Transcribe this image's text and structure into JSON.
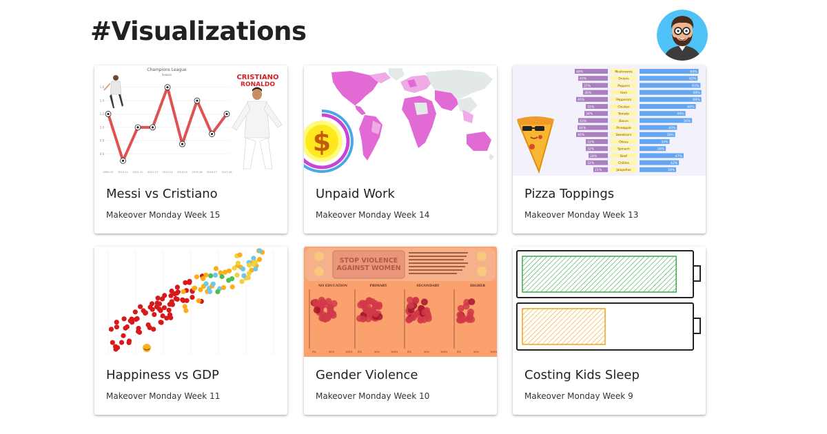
{
  "page": {
    "title": "#Visualizations"
  },
  "profile": {
    "avatar_icon": "bearded-man-avatar",
    "avatar_bg": "#4fc3f7"
  },
  "cards": [
    {
      "title": "Messi vs Cristiano",
      "subtitle": "Makeover Monday Week 15",
      "thumbnail": {
        "icon": "line-chart-thumbnail",
        "chart_title": "Champions League",
        "chart_subtitle": "Season",
        "player_name_line1": "CRISTIANO",
        "player_name_line2": "RONALDO",
        "seasons": [
          "2009-10",
          "2010-11",
          "2011-12",
          "2012-13",
          "2013-14",
          "2014-15",
          "2015-16",
          "2016-17",
          "2017-18"
        ],
        "values": [
          1.2,
          0.5,
          1.0,
          1.0,
          1.6,
          0.75,
          1.4,
          0.9,
          1.2
        ],
        "ylim": [
          0.4,
          1.7
        ],
        "yticks": [
          "1.6",
          "1.4",
          "1.2",
          "1.0",
          "0.8",
          "0.6"
        ],
        "line_color": "#e05252"
      }
    },
    {
      "title": "Unpaid Work",
      "subtitle": "Makeover Monday Week 14",
      "thumbnail": {
        "icon": "world-map-thumbnail",
        "accent": "#e26ad5",
        "symbol": "$"
      }
    },
    {
      "title": "Pizza Toppings",
      "subtitle": "Makeover Monday Week 13",
      "thumbnail": {
        "icon": "diverging-bar-thumbnail",
        "toppings": [
          "Mushrooms",
          "Onions",
          "Peppers",
          "Ham",
          "Pepperoni",
          "Chicken",
          "Tomato",
          "Bacon",
          "Pineapple",
          "Sweetcorn",
          "Olives",
          "Spinach",
          "Beef",
          "Chillies",
          "Jalapeños"
        ],
        "left_values": [
          48,
          43,
          37,
          36,
          46,
          32,
          34,
          43,
          44,
          46,
          32,
          32,
          28,
          32,
          21
        ],
        "right_values": [
          63,
          62,
          65,
          66,
          66,
          60,
          49,
          56,
          40,
          38,
          32,
          28,
          47,
          42,
          39
        ],
        "left_color": "#a97fc0",
        "right_color": "#64a7f0"
      }
    },
    {
      "title": "Happiness vs GDP",
      "subtitle": "Makeover Monday Week 11",
      "thumbnail": {
        "icon": "scatter-plot-thumbnail",
        "colors": [
          "#d7191c",
          "#fdae17",
          "#4dbd55",
          "#6fc7e8",
          "#f4d03f"
        ]
      }
    },
    {
      "title": "Gender Violence",
      "subtitle": "Makeover Monday Week 10",
      "thumbnail": {
        "icon": "beeswarm-thumbnail",
        "headline_line1": "STOP VIOLENCE",
        "headline_line2": "AGAINST WOMEN",
        "groups": [
          "NO EDUCATION",
          "PRIMARY",
          "SECONDARY",
          "HIGHER"
        ],
        "bg_color": "#fba16d"
      }
    },
    {
      "title": "Costing Kids Sleep",
      "subtitle": "Makeover Monday Week 9",
      "thumbnail": {
        "icon": "battery-thumbnail",
        "battery_levels": [
          0.93,
          0.5
        ],
        "battery_colors": [
          "#3aa84a",
          "#f0a21a"
        ]
      }
    }
  ]
}
